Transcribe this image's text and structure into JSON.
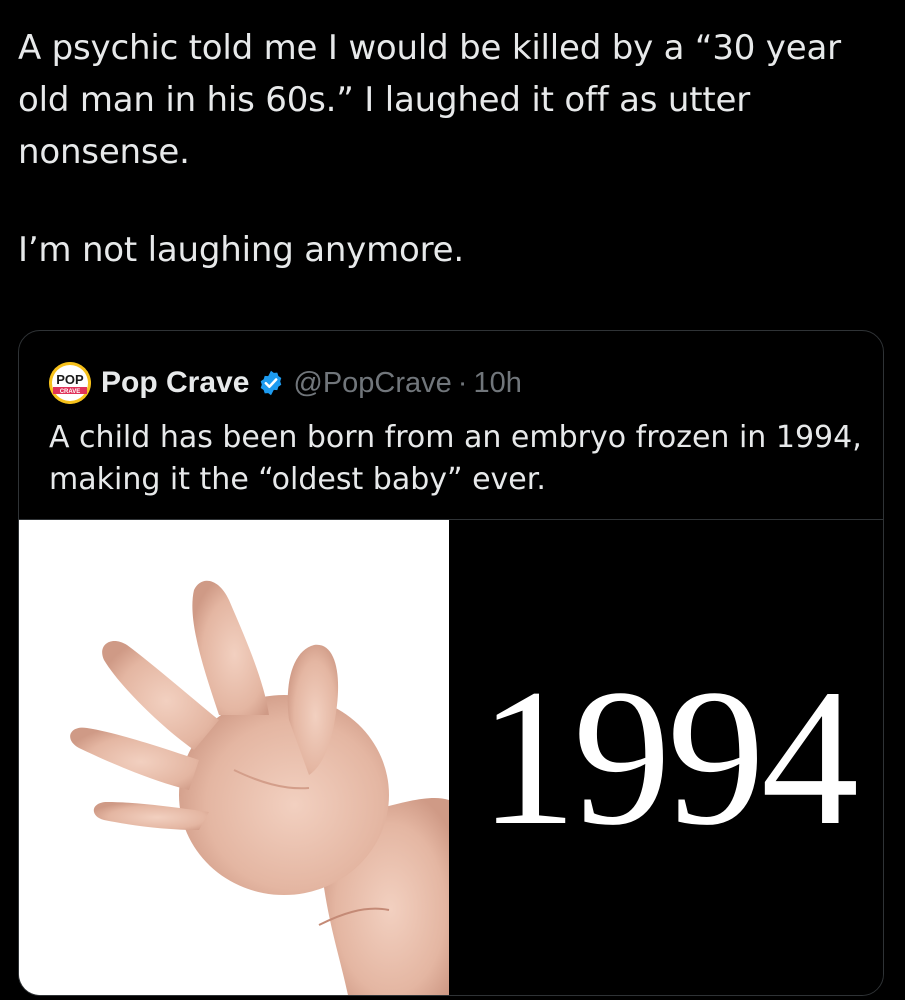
{
  "tweet": {
    "line1": "A psychic told me I would be killed by a “30 year old man in his 60s.” I laughed it off as utter nonsense.",
    "line2": "I’m not laughing anymore."
  },
  "quoted_tweet": {
    "author_name": "Pop Crave",
    "handle": "@PopCrave",
    "separator": "·",
    "time": "10h",
    "verified": true,
    "avatar_text_top": "POP",
    "avatar_text_bottom": "CRAVE",
    "text": "A child has been born from an embryo frozen in 1994, making it the “oldest baby” ever.",
    "media": {
      "year_text": "1994",
      "left_image": "baby-hand-photo"
    }
  },
  "colors": {
    "background": "#000000",
    "text_primary": "#e7e9ea",
    "text_secondary": "#71767b",
    "border": "#2f3336",
    "verified_blue": "#1d9bf0",
    "avatar_yellow": "#f6c11b"
  }
}
